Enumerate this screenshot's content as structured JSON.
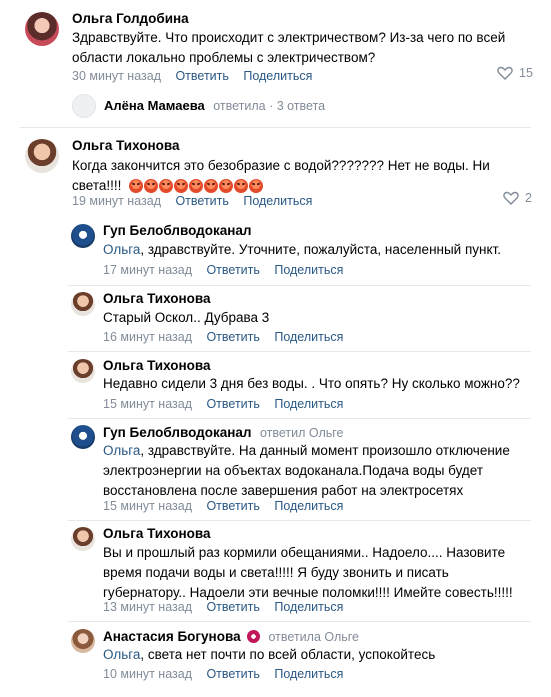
{
  "comments": [
    {
      "author": "Ольга Голдобина",
      "text_line1": "Здравствуйте. Что происходит с электричеством? Из-за чего по всей",
      "text_line2": "области локально проблемы с электричеством?",
      "time": "30 минут назад",
      "reply": "Ответить",
      "share": "Поделиться",
      "likes": "15",
      "thread": {
        "author": "Алёна Мамаева",
        "action": "ответила · 3 ответа"
      }
    },
    {
      "author": "Ольга Тихонова",
      "text_line1": "Когда закончится это безобразие с водой??????? Нет не воды. Ни",
      "text_line2": "света!!!!",
      "time": "19 минут назад",
      "reply": "Ответить",
      "share": "Поделиться",
      "likes": "2"
    }
  ],
  "replies": [
    {
      "author": "Гуп Белоблводоканал",
      "mention": "Ольга",
      "text": ", здравствуйте. Уточните, пожалуйста, населенный пункт.",
      "time": "17 минут назад",
      "reply": "Ответить",
      "share": "Поделиться"
    },
    {
      "author": "Ольга Тихонова",
      "text": "Старый Оскол.. Дубрава 3",
      "time": "16 минут назад",
      "reply": "Ответить",
      "share": "Поделиться"
    },
    {
      "author": "Ольга Тихонова",
      "text": "Недавно сидели 3 дня без воды. . Что опять? Ну сколько можно??",
      "time": "15 минут назад",
      "reply": "Ответить",
      "share": "Поделиться"
    },
    {
      "author": "Гуп Белоблводоканал",
      "sub": "ответил Ольге",
      "mention": "Ольга",
      "text_line1": ", здравствуйте. На данный момент произошло отключение",
      "text_line2": "электроэнергии на объектах водоканала.Подача воды будет",
      "text_line3": "восстановлена после завершения работ на электросетях",
      "time": "15 минут назад",
      "reply": "Ответить",
      "share": "Поделиться"
    },
    {
      "author": "Ольга Тихонова",
      "text_line1": "Вы и прошлый раз кормили обещаниями.. Надоело.... Назовите",
      "text_line2": "время подачи воды и света!!!!! Я буду звонить и писать",
      "text_line3": "губернатору.. Надоели эти вечные поломки!!!! Имейте совесть!!!!!",
      "time": "13 минут назад",
      "reply": "Ответить",
      "share": "Поделиться"
    },
    {
      "author": "Анастасия Богунова",
      "sub": "ответила Ольге",
      "mention": "Ольга",
      "text": ", света нет почти по всей области, успокойтесь",
      "time": "10 минут назад",
      "reply": "Ответить",
      "share": "Поделиться"
    }
  ],
  "colors": {
    "link": "#2a5885",
    "meta": "#818c99",
    "divider": "#e7e8ec"
  },
  "icons": {
    "like": "heart-icon",
    "angry_emoji": "angry-face-emoji"
  }
}
